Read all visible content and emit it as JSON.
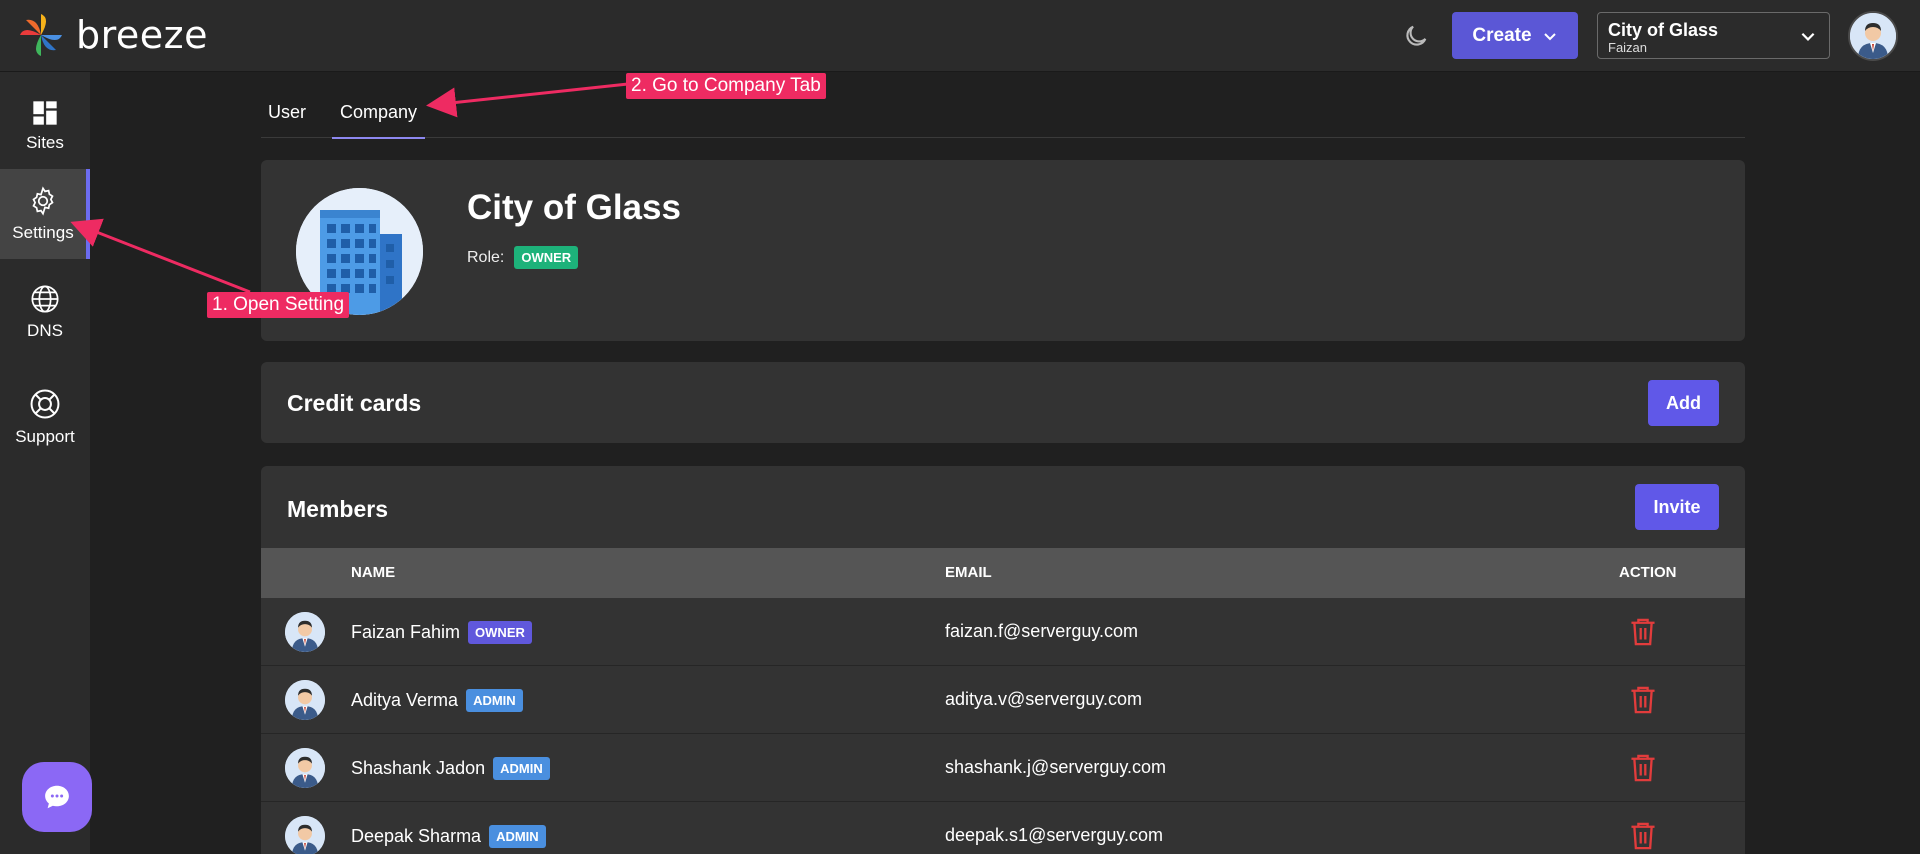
{
  "app": {
    "brand": "breeze"
  },
  "header": {
    "create_label": "Create",
    "company_name": "City of Glass",
    "company_user": "Faizan"
  },
  "sidebar": {
    "items": [
      {
        "label": "Sites",
        "icon": "dashboard-icon"
      },
      {
        "label": "Settings",
        "icon": "gear-icon",
        "active": true
      },
      {
        "label": "DNS",
        "icon": "globe-icon"
      },
      {
        "label": "Support",
        "icon": "lifebuoy-icon"
      }
    ]
  },
  "tabs": [
    {
      "label": "User"
    },
    {
      "label": "Company",
      "active": true
    }
  ],
  "company": {
    "name": "City of Glass",
    "role_label": "Role:",
    "role": "OWNER"
  },
  "credit_cards": {
    "title": "Credit cards",
    "add_label": "Add"
  },
  "members": {
    "title": "Members",
    "invite_label": "Invite",
    "columns": [
      "NAME",
      "EMAIL",
      "ACTION"
    ],
    "rows": [
      {
        "name": "Faizan Fahim",
        "role": "OWNER",
        "email": "faizan.f@serverguy.com"
      },
      {
        "name": "Aditya Verma",
        "role": "ADMIN",
        "email": "aditya.v@serverguy.com"
      },
      {
        "name": "Shashank Jadon",
        "role": "ADMIN",
        "email": "shashank.j@serverguy.com"
      },
      {
        "name": "Deepak Sharma",
        "role": "ADMIN",
        "email": "deepak.s1@serverguy.com"
      }
    ]
  },
  "annotations": {
    "step1": "1. Open Setting",
    "step2": "2. Go to Company Tab"
  },
  "colors": {
    "accent": "#5b57d6",
    "owner_green": "#1db27a",
    "admin_blue": "#4a8fdf",
    "annotation_pink": "#ee2b62",
    "delete_red": "#e23c3c"
  }
}
